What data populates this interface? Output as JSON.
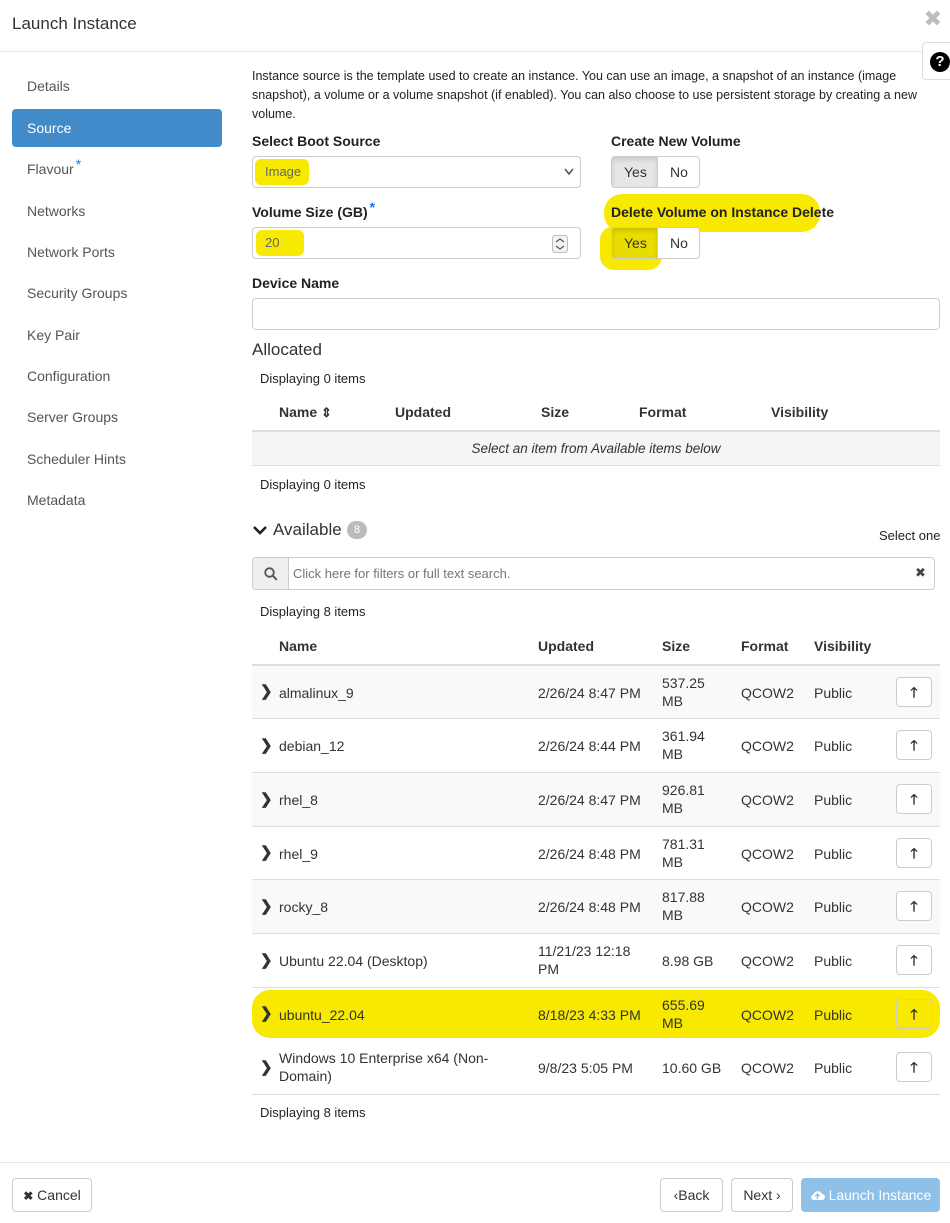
{
  "dialog": {
    "title": "Launch Instance",
    "close_glyph": "✖",
    "help_glyph": "?"
  },
  "sidebar": {
    "items": [
      {
        "label": "Details",
        "required": false
      },
      {
        "label": "Source",
        "required": false
      },
      {
        "label": "Flavour",
        "required": true
      },
      {
        "label": "Networks",
        "required": false
      },
      {
        "label": "Network Ports",
        "required": false
      },
      {
        "label": "Security Groups",
        "required": false
      },
      {
        "label": "Key Pair",
        "required": false
      },
      {
        "label": "Configuration",
        "required": false
      },
      {
        "label": "Server Groups",
        "required": false
      },
      {
        "label": "Scheduler Hints",
        "required": false
      },
      {
        "label": "Metadata",
        "required": false
      }
    ],
    "active": "Source",
    "required_mark": "*"
  },
  "source": {
    "intro": "Instance source is the template used to create an instance. You can use an image, a snapshot of an instance (image snapshot), a volume or a volume snapshot (if enabled). You can also choose to use persistent storage by creating a new volume.",
    "boot_source_label": "Select Boot Source",
    "boot_source_value": "Image",
    "create_volume_label": "Create New Volume",
    "create_volume_yes": "Yes",
    "create_volume_no": "No",
    "create_volume_selected": "Yes",
    "volume_size_label": "Volume Size (GB)",
    "volume_size_value": "20",
    "delete_volume_label": "Delete Volume on Instance Delete",
    "delete_volume_yes": "Yes",
    "delete_volume_no": "No",
    "delete_volume_selected": "Yes",
    "device_name_label": "Device Name",
    "device_name_value": ""
  },
  "allocated": {
    "title": "Allocated",
    "count_text_top": "Displaying 0 items",
    "count_text_bottom": "Displaying 0 items",
    "columns": [
      "Name",
      "Updated",
      "Size",
      "Format",
      "Visibility"
    ],
    "sort_glyph": "⇕",
    "empty_text": "Select an item from Available items below"
  },
  "available": {
    "title": "Available",
    "count": "8",
    "select_hint": "Select one",
    "search_placeholder": "Click here for filters or full text search.",
    "search_value": "",
    "count_text_top": "Displaying 8 items",
    "count_text_bottom": "Displaying 8 items",
    "columns": [
      "Name",
      "Updated",
      "Size",
      "Format",
      "Visibility"
    ],
    "rows": [
      {
        "name": "almalinux_9",
        "updated": "2/26/24 8:47 PM",
        "size": "537.25 MB",
        "format": "QCOW2",
        "visibility": "Public",
        "highlight": false
      },
      {
        "name": "debian_12",
        "updated": "2/26/24 8:44 PM",
        "size": "361.94 MB",
        "format": "QCOW2",
        "visibility": "Public",
        "highlight": false
      },
      {
        "name": "rhel_8",
        "updated": "2/26/24 8:47 PM",
        "size": "926.81 MB",
        "format": "QCOW2",
        "visibility": "Public",
        "highlight": false
      },
      {
        "name": "rhel_9",
        "updated": "2/26/24 8:48 PM",
        "size": "781.31 MB",
        "format": "QCOW2",
        "visibility": "Public",
        "highlight": false
      },
      {
        "name": "rocky_8",
        "updated": "2/26/24 8:48 PM",
        "size": "817.88 MB",
        "format": "QCOW2",
        "visibility": "Public",
        "highlight": false
      },
      {
        "name": "Ubuntu 22.04 (Desktop)",
        "updated": "11/21/23 12:18 PM",
        "size": "8.98 GB",
        "format": "QCOW2",
        "visibility": "Public",
        "highlight": false
      },
      {
        "name": "ubuntu_22.04",
        "updated": "8/18/23 4:33 PM",
        "size": "655.69 MB",
        "format": "QCOW2",
        "visibility": "Public",
        "highlight": true
      },
      {
        "name": "Windows 10 Enterprise x64 (Non-Domain)",
        "updated": "9/8/23 5:05 PM",
        "size": "10.60 GB",
        "format": "QCOW2",
        "visibility": "Public",
        "highlight": false
      }
    ]
  },
  "footer": {
    "cancel_label": "Cancel",
    "back_label": "Back",
    "next_label": "Next",
    "launch_label": "Launch Instance"
  },
  "colors": {
    "active_nav": "#428bca",
    "highlight": "#f7e900",
    "launch_button": "#8fc0e8",
    "required_star": "#1a73e8"
  },
  "icons": [
    "close-icon",
    "help-icon",
    "caret-down-icon",
    "spinner-icon",
    "sort-icon",
    "chevron-down-icon",
    "search-icon",
    "clear-icon",
    "chevron-right-icon",
    "arrow-up-icon",
    "cancel-x-icon",
    "chevron-left-icon",
    "chevron-right-icon",
    "cloud-upload-icon"
  ]
}
